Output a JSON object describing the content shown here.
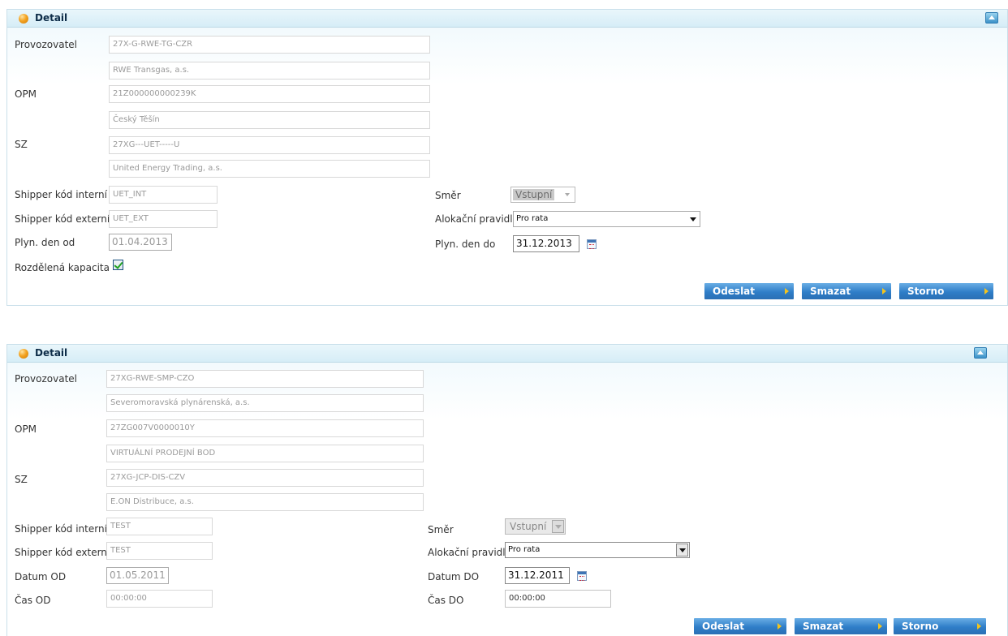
{
  "panels": [
    {
      "title": "Detail",
      "labels": {
        "provozovatel": "Provozovatel",
        "opm": "OPM",
        "sz": "SZ",
        "shipper_interni": "Shipper kód interní",
        "shipper_externi": "Shipper kód externí",
        "date_from": "Plyn. den od",
        "rozdelena": "Rozdělená kapacita",
        "smer": "Směr",
        "alokacni": "Alokační pravidlo",
        "date_to": "Plyn. den do"
      },
      "values": {
        "provozovatel_code": "27X-G-RWE-TG-CZR",
        "provozovatel_name": "RWE Transgas, a.s.",
        "opm_code": "21Z000000000239K",
        "opm_name": "Český Těšín",
        "sz_code": "27XG---UET-----U",
        "sz_name": "United Energy Trading, a.s.",
        "shipper_interni": "UET_INT",
        "shipper_externi": "UET_EXT",
        "date_from": "01.04.2013",
        "smer": "Vstupní",
        "alokacni": "Pro rata",
        "date_to": "31.12.2013",
        "rozdelena_checked": true
      },
      "buttons": {
        "send": "Odeslat",
        "delete": "Smazat",
        "cancel": "Storno"
      }
    },
    {
      "title": "Detail",
      "labels": {
        "provozovatel": "Provozovatel",
        "opm": "OPM",
        "sz": "SZ",
        "shipper_interni": "Shipper kód interní",
        "shipper_externi": "Shipper kód externí",
        "date_from": "Datum OD",
        "time_from": "Čas OD",
        "smer": "Směr",
        "alokacni": "Alokační pravidlo",
        "date_to": "Datum DO",
        "time_to": "Čas DO"
      },
      "values": {
        "provozovatel_code": "27XG-RWE-SMP-CZO",
        "provozovatel_name": "Severomoravská plynárenská, a.s.",
        "opm_code": "27ZG007V0000010Y",
        "opm_name": "VIRTUÁLNÍ PRODEJNÍ BOD",
        "sz_code": "27XG-JCP-DIS-CZV",
        "sz_name": "E.ON Distribuce, a.s.",
        "shipper_interni": "TEST",
        "shipper_externi": "TEST",
        "date_from": "01.05.2011",
        "time_from": "00:00:00",
        "smer": "Vstupní",
        "alokacni": "Pro rata",
        "date_to": "31.12.2011",
        "time_to": "00:00:00"
      },
      "buttons": {
        "send": "Odeslat",
        "delete": "Smazat",
        "cancel": "Storno"
      }
    }
  ],
  "colors": {
    "header_title": "#0d2c48",
    "button_blue": "#2f7ec8",
    "button_arrow": "#f3c31d",
    "border": "#c9dfea"
  }
}
